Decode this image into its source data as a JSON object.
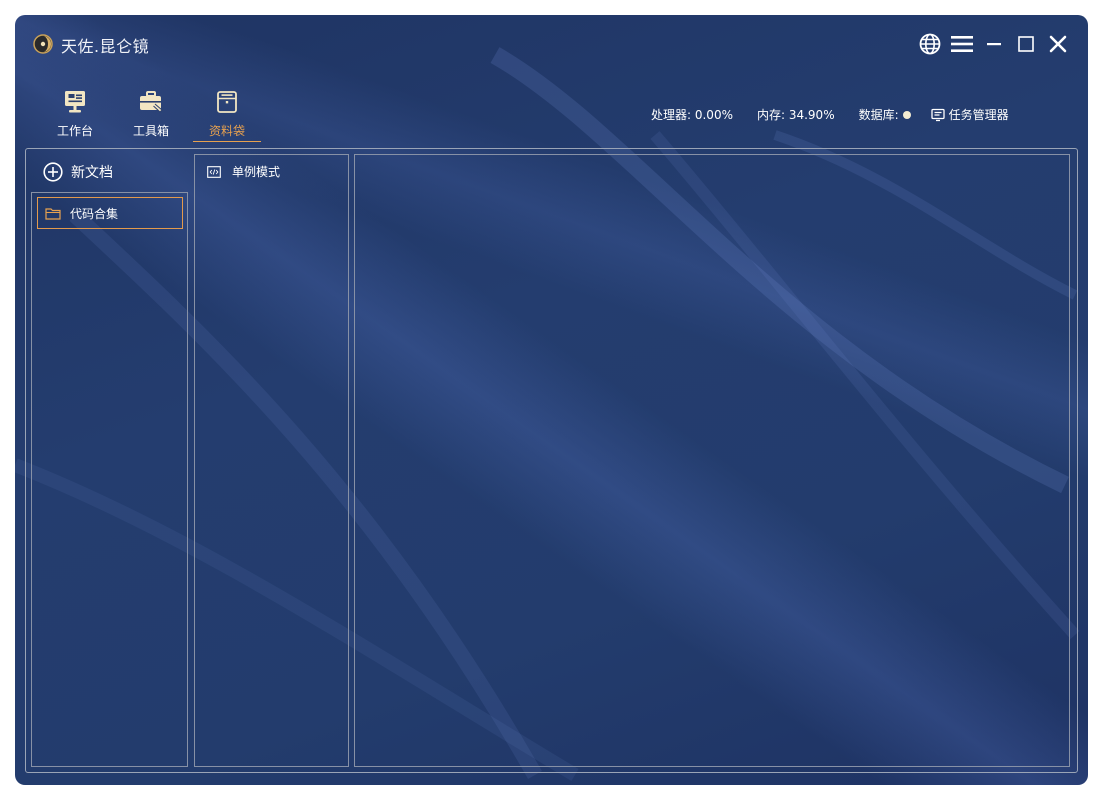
{
  "app": {
    "title": "天佐.昆仑镜"
  },
  "window_controls": [
    "globe-icon",
    "menu-icon",
    "minimize-icon",
    "maximize-icon",
    "close-icon"
  ],
  "nav": [
    {
      "label": "工作台",
      "icon": "workbench-icon",
      "active": false
    },
    {
      "label": "工具箱",
      "icon": "toolbox-icon",
      "active": false
    },
    {
      "label": "资料袋",
      "icon": "bag-icon",
      "active": true
    }
  ],
  "status": {
    "cpu": "处理器: 0.00%",
    "mem": "内存: 34.90%",
    "db": "数据库:",
    "task_manager": "任务管理器"
  },
  "sidebar": {
    "new_doc": "新文档",
    "folders": [
      {
        "label": "代码合集",
        "selected": true
      }
    ]
  },
  "file_list": [
    {
      "label": "单例模式",
      "icon": "code-file-icon"
    }
  ],
  "colors": {
    "accent": "#e7a14f",
    "background": "#243d6f",
    "db_status": "#f4ecd2"
  }
}
